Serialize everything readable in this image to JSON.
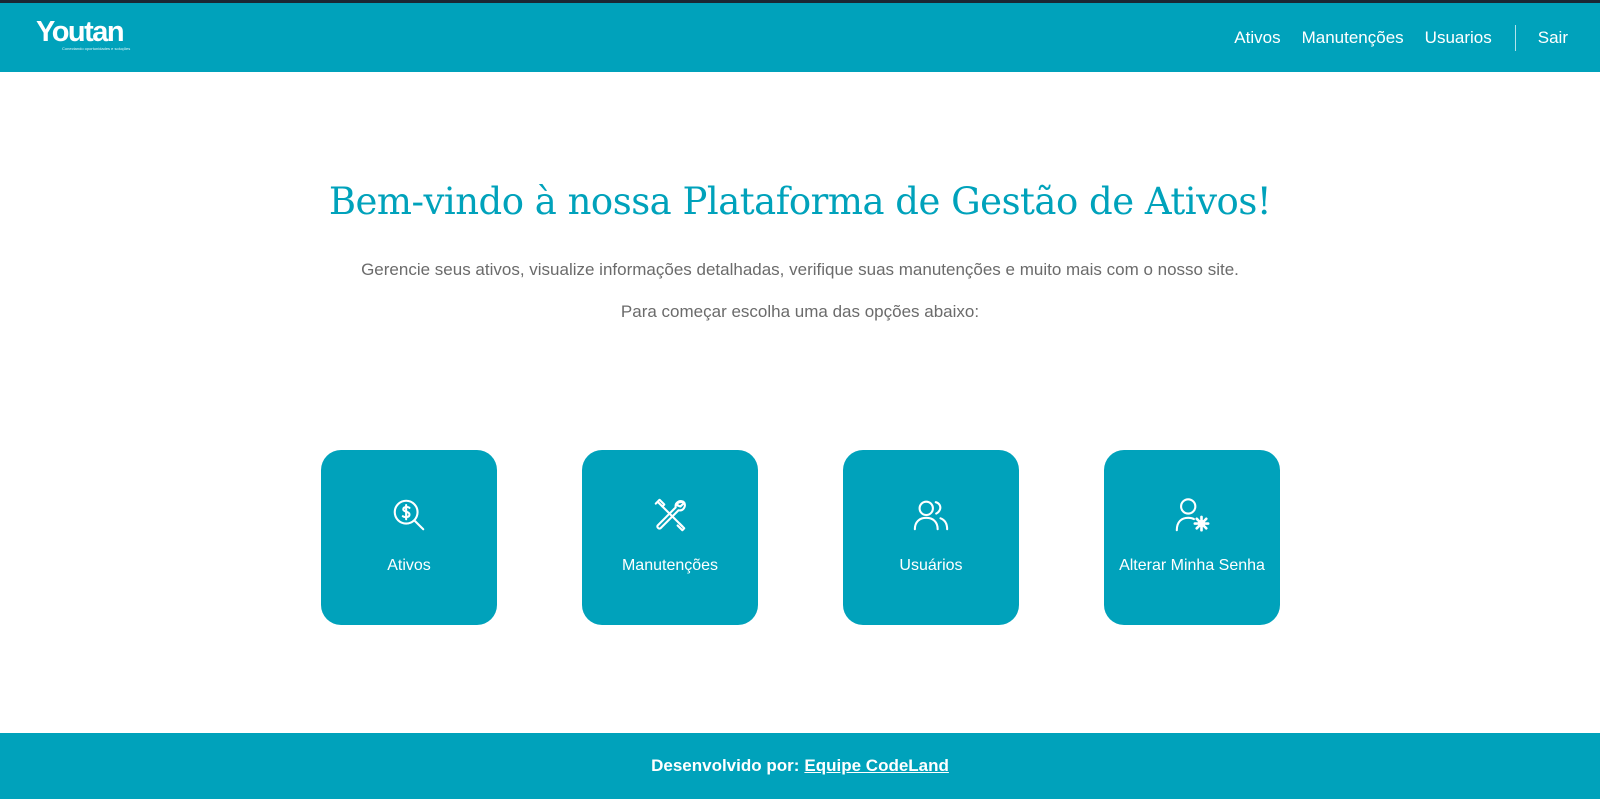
{
  "brand": {
    "name": "Youtan",
    "tagline": "Conectando oportunidades e soluções"
  },
  "nav": {
    "items": [
      {
        "label": "Ativos"
      },
      {
        "label": "Manutenções"
      },
      {
        "label": "Usuarios"
      }
    ],
    "logout_label": "Sair"
  },
  "hero": {
    "title": "Bem-vindo à nossa Plataforma de Gestão de Ativos!",
    "subtitle": "Gerencie seus ativos, visualize informações detalhadas, verifique suas manutenções e muito mais com o nosso site.",
    "instruction": "Para começar escolha uma das opções abaixo:"
  },
  "cards": [
    {
      "label": "Ativos",
      "icon": "dollar-search-icon"
    },
    {
      "label": "Manutenções",
      "icon": "tools-icon"
    },
    {
      "label": "Usuários",
      "icon": "users-icon"
    },
    {
      "label": "Alterar Minha Senha",
      "icon": "user-settings-icon"
    }
  ],
  "footer": {
    "prefix": "Desenvolvido por:",
    "link_label": "Equipe CodeLand"
  },
  "colors": {
    "primary": "#00a2bb",
    "text_muted": "#6b6b6b",
    "background": "#ffffff"
  }
}
